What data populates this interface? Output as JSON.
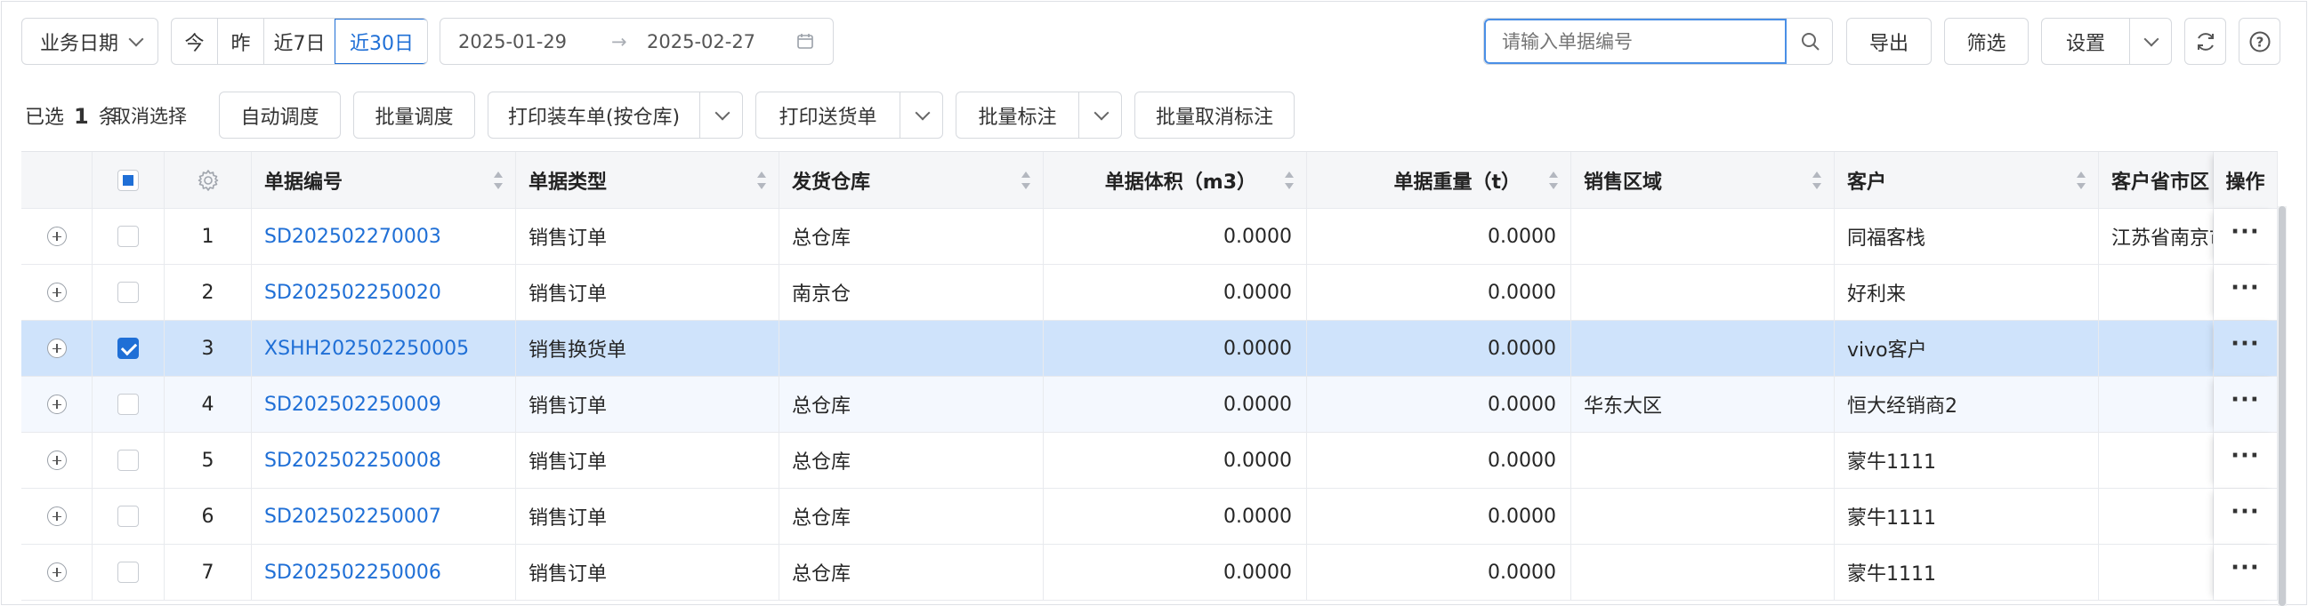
{
  "toolbar": {
    "date_type": "业务日期",
    "quick_dates": [
      "今",
      "昨",
      "近7日",
      "近30日"
    ],
    "active_quick_date": "近30日",
    "date_start": "2025-01-29",
    "date_sep": "→",
    "date_end": "2025-02-27",
    "search_placeholder": "请输入单据编号",
    "export_label": "导出",
    "filter_label": "筛选",
    "settings_label": "设置"
  },
  "actions": {
    "selected_prefix": "已选",
    "selected_count": "1",
    "selected_suffix": "条",
    "cancel_selection": "取消选择",
    "auto_dispatch": "自动调度",
    "batch_dispatch": "批量调度",
    "print_loading": "打印装车单(按仓库)",
    "print_delivery": "打印送货单",
    "batch_mark": "批量标注",
    "batch_unmark": "批量取消标注"
  },
  "table": {
    "columns": [
      "单据编号",
      "单据类型",
      "发货仓库",
      "单据体积（m3）",
      "单据重量（t）",
      "销售区域",
      "客户",
      "客户省市区",
      "操作"
    ],
    "rows": [
      {
        "index": "1",
        "code": "SD202502270003",
        "type": "销售订单",
        "warehouse": "总仓库",
        "volume": "0.0000",
        "weight": "0.0000",
        "region": "",
        "customer": "同福客栈",
        "province": "江苏省南京市",
        "checked": false
      },
      {
        "index": "2",
        "code": "SD202502250020",
        "type": "销售订单",
        "warehouse": "南京仓",
        "volume": "0.0000",
        "weight": "0.0000",
        "region": "",
        "customer": "好利来",
        "province": "",
        "checked": false
      },
      {
        "index": "3",
        "code": "XSHH202502250005",
        "type": "销售换货单",
        "warehouse": "",
        "volume": "0.0000",
        "weight": "0.0000",
        "region": "",
        "customer": "vivo客户",
        "province": "",
        "checked": true
      },
      {
        "index": "4",
        "code": "SD202502250009",
        "type": "销售订单",
        "warehouse": "总仓库",
        "volume": "0.0000",
        "weight": "0.0000",
        "region": "华东大区",
        "customer": "恒大经销商2",
        "province": "",
        "checked": false
      },
      {
        "index": "5",
        "code": "SD202502250008",
        "type": "销售订单",
        "warehouse": "总仓库",
        "volume": "0.0000",
        "weight": "0.0000",
        "region": "",
        "customer": "蒙牛1111",
        "province": "",
        "checked": false
      },
      {
        "index": "6",
        "code": "SD202502250007",
        "type": "销售订单",
        "warehouse": "总仓库",
        "volume": "0.0000",
        "weight": "0.0000",
        "region": "",
        "customer": "蒙牛1111",
        "province": "",
        "checked": false
      },
      {
        "index": "7",
        "code": "SD202502250006",
        "type": "销售订单",
        "warehouse": "总仓库",
        "volume": "0.0000",
        "weight": "0.0000",
        "region": "",
        "customer": "蒙牛1111",
        "province": "",
        "checked": false
      }
    ],
    "more_glyph": "···"
  },
  "colors": {
    "accent": "#1f6fd6",
    "selected_row": "#cfe3fb",
    "header_bg": "#f5f6f8"
  }
}
